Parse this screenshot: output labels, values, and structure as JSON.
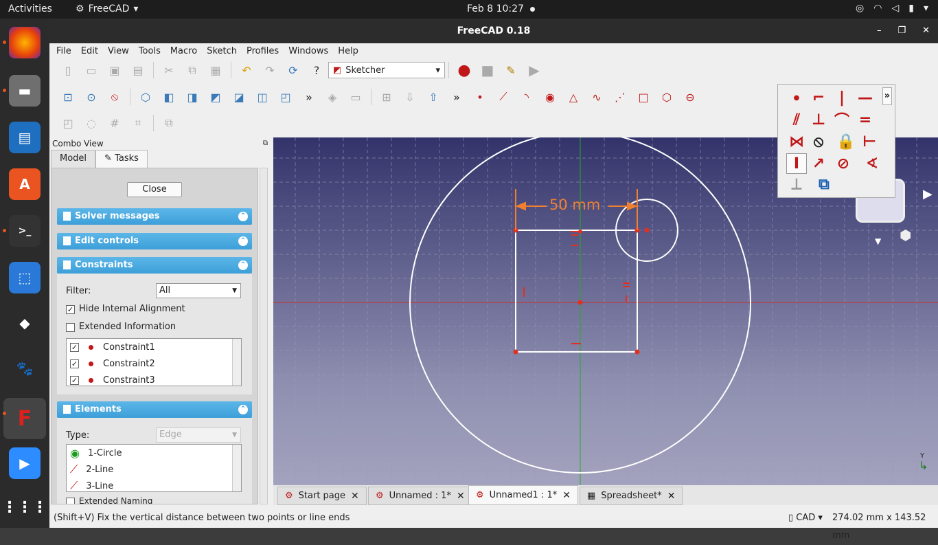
{
  "topbar": {
    "activities": "Activities",
    "app_name": "FreeCAD",
    "clock": "Feb 8  10:27"
  },
  "window": {
    "title": "FreeCAD 0.18",
    "min": "–",
    "max": "❐",
    "close": "✕"
  },
  "menu": [
    "File",
    "Edit",
    "View",
    "Tools",
    "Macro",
    "Sketch",
    "Profiles",
    "Windows",
    "Help"
  ],
  "workbench": {
    "selected": "Sketcher"
  },
  "combo": {
    "title": "Combo View",
    "tabs": {
      "model": "Model",
      "tasks": "Tasks"
    },
    "close_btn": "Close",
    "sections": {
      "solver": "Solver messages",
      "edit": "Edit controls",
      "constraints": "Constraints",
      "elements": "Elements"
    },
    "constraints": {
      "filter_label": "Filter:",
      "filter_value": "All",
      "hide_internal": "Hide Internal Alignment",
      "extended_info": "Extended Information",
      "items": [
        "Constraint1",
        "Constraint2",
        "Constraint3"
      ]
    },
    "elements": {
      "type_label": "Type:",
      "type_value": "Edge",
      "items": [
        "1-Circle",
        "2-Line",
        "3-Line"
      ],
      "extended_naming": "Extended Naming"
    }
  },
  "view": {
    "dimension_label": "50 mm",
    "axes_label": "Y"
  },
  "doc_tabs": {
    "start": "Start page",
    "unnamed": "Unnamed : 1*",
    "unnamed1": "Unnamed1 : 1*",
    "spreadsheet": "Spreadsheet*"
  },
  "status": {
    "message": "(Shift+V) Fix the vertical distance between two points or line ends",
    "nav": "CAD",
    "dims": "274.02 mm x 143.52 mm"
  },
  "colors": {
    "accent": "#3d9fd9",
    "constraint_red": "#c01818",
    "sketch_white": "#ffffff"
  }
}
